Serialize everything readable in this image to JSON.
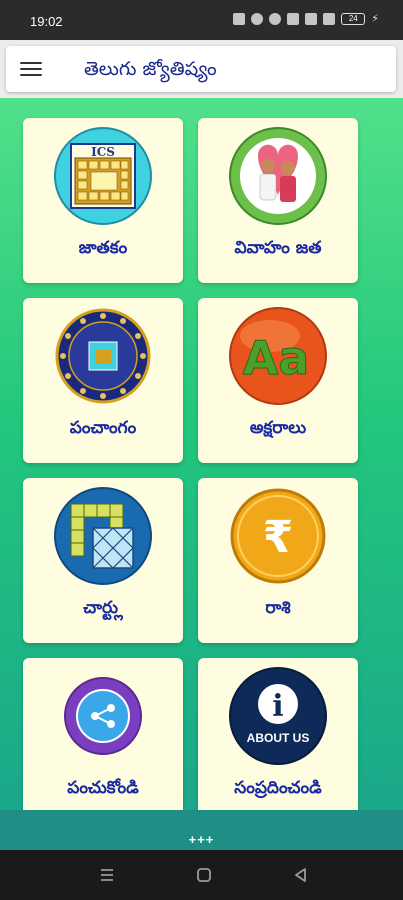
{
  "status": {
    "time": "19:02",
    "battery": "24"
  },
  "toolbar": {
    "title": "తెలుగు జ్యోతిష్యం"
  },
  "tiles": [
    {
      "label": "జాతకం",
      "badge": "ICS"
    },
    {
      "label": "వివాహం జత"
    },
    {
      "label": "పంచాంగం"
    },
    {
      "label": "అక్షరాలు",
      "badge": "Aa"
    },
    {
      "label": "చార్ట్లు"
    },
    {
      "label": "రాశి",
      "badge": "₹"
    },
    {
      "label": "పంచుకోండి"
    },
    {
      "label": "సంప్రదించండి",
      "badge": "ABOUT US"
    }
  ],
  "more": "+++",
  "colors": {
    "accent": "#1a2aa0",
    "tile_bg": "#fffde0",
    "gradient_top": "#52e08a",
    "gradient_bottom": "#1aa88a"
  }
}
